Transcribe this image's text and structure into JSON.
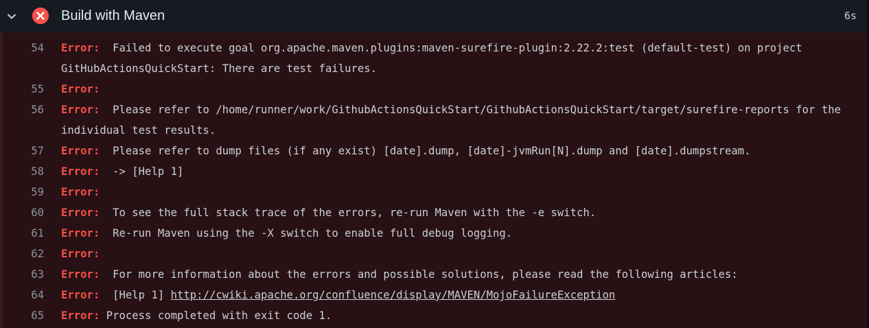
{
  "step": {
    "title": "Build with Maven",
    "duration": "6s",
    "status": "failed",
    "status_color": "#f85149",
    "icons": {
      "toggle": "chevron-down-icon",
      "status": "x-circle-fill-icon"
    }
  },
  "log": {
    "lines": [
      {
        "num": "54",
        "prefix": "Error:",
        "text": "  Failed to execute goal org.apache.maven.plugins:maven-surefire-plugin:2.22.2:test (default-test) on project GitHubActionsQuickStart: There are test failures.",
        "link": ""
      },
      {
        "num": "55",
        "prefix": "Error:",
        "text": "",
        "link": ""
      },
      {
        "num": "56",
        "prefix": "Error:",
        "text": "  Please refer to /home/runner/work/GithubActionsQuickStart/GithubActionsQuickStart/target/surefire-reports for the individual test results.",
        "link": ""
      },
      {
        "num": "57",
        "prefix": "Error:",
        "text": "  Please refer to dump files (if any exist) [date].dump, [date]-jvmRun[N].dump and [date].dumpstream.",
        "link": ""
      },
      {
        "num": "58",
        "prefix": "Error:",
        "text": "  -> [Help 1]",
        "link": ""
      },
      {
        "num": "59",
        "prefix": "Error:",
        "text": "",
        "link": ""
      },
      {
        "num": "60",
        "prefix": "Error:",
        "text": "  To see the full stack trace of the errors, re-run Maven with the -e switch.",
        "link": ""
      },
      {
        "num": "61",
        "prefix": "Error:",
        "text": "  Re-run Maven using the -X switch to enable full debug logging.",
        "link": ""
      },
      {
        "num": "62",
        "prefix": "Error:",
        "text": "",
        "link": ""
      },
      {
        "num": "63",
        "prefix": "Error:",
        "text": "  For more information about the errors and possible solutions, please read the following articles:",
        "link": ""
      },
      {
        "num": "64",
        "prefix": "Error:",
        "text": "  [Help 1] ",
        "link": "http://cwiki.apache.org/confluence/display/MAVEN/MojoFailureException"
      },
      {
        "num": "65",
        "prefix": "Error:",
        "text": " Process completed with exit code 1.",
        "link": ""
      }
    ]
  }
}
